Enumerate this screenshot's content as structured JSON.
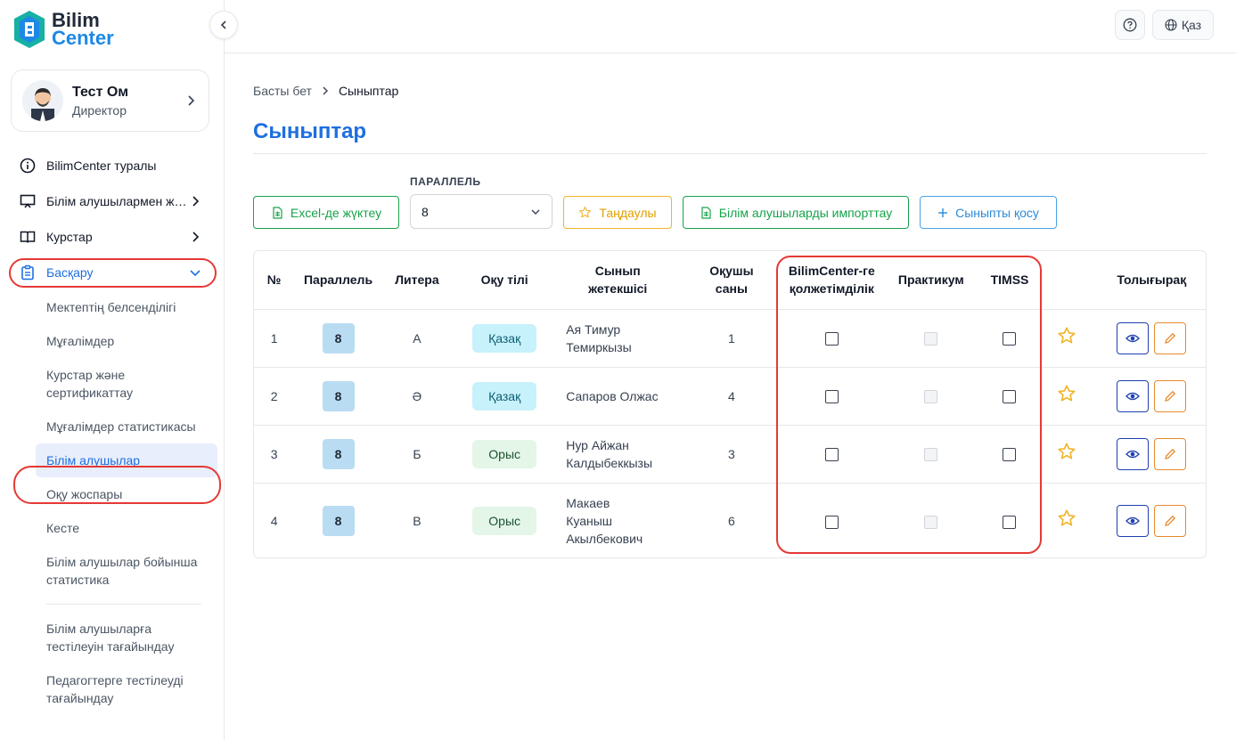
{
  "logo": {
    "line1": "Bilim",
    "line2": "Center"
  },
  "user": {
    "name": "Тест Ом",
    "role": "Директор"
  },
  "nav": {
    "items": [
      {
        "label": "BilimCenter туралы",
        "icon": "info-icon"
      },
      {
        "label": "Білім алушылармен жұмыс",
        "icon": "monitor-icon"
      },
      {
        "label": "Курстар",
        "icon": "book-icon"
      },
      {
        "label": "Басқару",
        "icon": "clipboard-icon"
      }
    ],
    "sub": [
      "Мектептің белсенділігі",
      "Мұғалімдер",
      "Курстар және сертификаттау",
      "Мұғалімдер статистикасы",
      "Білім алушылар",
      "Оқу жоспары",
      "Кесте",
      "Білім алушылар бойынша статистика",
      "Білім алушыларға тестілеуін тағайындау",
      "Педагогтерге тестілеуді тағайындау"
    ]
  },
  "topbar": {
    "lang": "Қаз"
  },
  "breadcrumb": {
    "home": "Басты бет",
    "current": "Сыныптар"
  },
  "page": {
    "title": "Сыныптар"
  },
  "toolbar": {
    "excel": "Excel-де жүктеу",
    "parallel_label": "ПАРАЛЛЕЛЬ",
    "parallel_value": "8",
    "favorites": "Таңдаулы",
    "import": "Білім алушыларды импорттау",
    "add_class": "Сыныпты қосу"
  },
  "table": {
    "headers": {
      "num": "№",
      "parallel": "Параллель",
      "litera": "Литера",
      "lang": "Оқу тілі",
      "teacher": "Сынып жетекшісі",
      "students": "Оқушы саны",
      "access": "BilimCenter-ге қолжетімділік",
      "practicum": "Практикум",
      "timss": "TIMSS",
      "more": "Толығырақ"
    },
    "rows": [
      {
        "num": "1",
        "parallel": "8",
        "litera": "А",
        "lang": "Қазақ",
        "teacher": "Ая Тимур Темиркызы",
        "students": "1"
      },
      {
        "num": "2",
        "parallel": "8",
        "litera": "Ә",
        "lang": "Қазақ",
        "teacher": "Сапаров Олжас",
        "students": "4"
      },
      {
        "num": "3",
        "parallel": "8",
        "litera": "Б",
        "lang": "Орыс",
        "teacher": "Нур Айжан Калдыбеккызы",
        "students": "3"
      },
      {
        "num": "4",
        "parallel": "8",
        "litera": "В",
        "lang": "Орыс",
        "teacher": "Макаев Куаныш Акылбекович",
        "students": "6"
      }
    ]
  },
  "colors": {
    "accent": "#1e6fe0",
    "highlight": "#e53935",
    "green": "#16a34a",
    "star": "#f0b429"
  }
}
